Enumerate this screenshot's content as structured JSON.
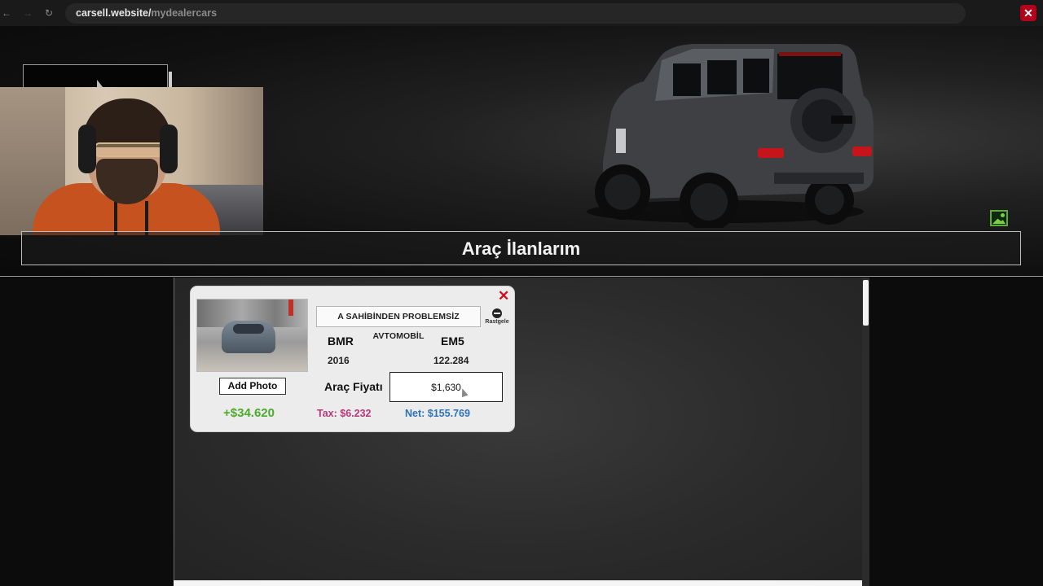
{
  "browser": {
    "url_host": "carsell.website/",
    "url_path": "mydealercars",
    "back_glyph": "←",
    "forward_glyph": "→",
    "reload_glyph": "↻",
    "close_glyph": "✕"
  },
  "hero": {
    "title": "Araç İlanlarım",
    "image_button_icon": "image-icon"
  },
  "listing": {
    "close_glyph": "✕",
    "ad_title": "A SAHİBİNDEN PROBLEMSİZ AVTOMOBİL",
    "random_label": "Rastgele",
    "brand": "BMR",
    "model": "EM5",
    "year": "2016",
    "mileage": "122.284",
    "add_photo_label": "Add Photo",
    "price_label": "Araç Fiyatı",
    "price_value": "$1,630",
    "profit": "+$34.620",
    "tax": "Tax: $6.232",
    "net": "Net: $155.769"
  },
  "colors": {
    "profit": "#4caa2c",
    "tax": "#b5377a",
    "net": "#2e73b8",
    "close": "#d0101a"
  }
}
